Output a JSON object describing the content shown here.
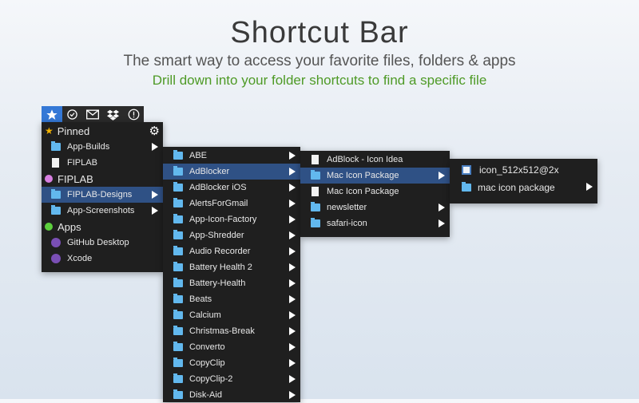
{
  "header": {
    "title": "Shortcut Bar",
    "subtitle": "The smart way to access your favorite files, folders & apps",
    "tagline": "Drill down into your folder shortcuts to find a specific file"
  },
  "colors": {
    "accent": "#3478d6",
    "tagline": "#4e9a26",
    "selection": "#2f5185",
    "folder": "#62b8ee",
    "fiplab_dot": "#d77fe0",
    "apps_dot": "#5ccf3d",
    "pinned_star": "#f5b400"
  },
  "tabs": [
    {
      "icon": "star-icon",
      "active": true
    },
    {
      "icon": "checkmark-icon"
    },
    {
      "icon": "mail-icon"
    },
    {
      "icon": "dropbox-icon"
    },
    {
      "icon": "info-icon"
    }
  ],
  "menu1": {
    "sections": [
      {
        "label": "Pinned",
        "icon": "star-icon",
        "items": [
          {
            "label": "App-Builds",
            "type": "folder",
            "sub": true
          },
          {
            "label": "FIPLAB",
            "type": "file"
          }
        ]
      },
      {
        "label": "FIPLAB",
        "icon": "dot",
        "items": [
          {
            "label": "FIPLAB-Designs",
            "type": "folder",
            "sub": true,
            "selected": true
          },
          {
            "label": "App-Screenshots",
            "type": "folder",
            "sub": true
          }
        ]
      },
      {
        "label": "Apps",
        "icon": "dot",
        "items": [
          {
            "label": "GitHub Desktop",
            "type": "app"
          },
          {
            "label": "Xcode",
            "type": "app"
          }
        ]
      }
    ]
  },
  "menu2": [
    "ABE",
    "AdBlocker",
    "AdBlocker iOS",
    "AlertsForGmail",
    "App-Icon-Factory",
    "App-Shredder",
    "Audio Recorder",
    "Battery Health 2",
    "Battery-Health",
    "Beats",
    "Calcium",
    "Christmas-Break",
    "Converto",
    "CopyClip",
    "CopyClip-2",
    "Disk-Aid"
  ],
  "menu3": [
    {
      "label": "AdBlock - Icon Idea",
      "type": "file"
    },
    {
      "label": "Mac Icon Package",
      "type": "folder",
      "sub": true,
      "selected": true
    },
    {
      "label": "Mac Icon Package",
      "type": "file"
    },
    {
      "label": "newsletter",
      "type": "folder",
      "sub": true
    },
    {
      "label": "safari-icon",
      "type": "folder",
      "sub": true
    }
  ],
  "menu4": [
    {
      "label": "icon_512x512@2x",
      "type": "image"
    },
    {
      "label": "mac icon package",
      "type": "folder",
      "sub": true
    }
  ]
}
